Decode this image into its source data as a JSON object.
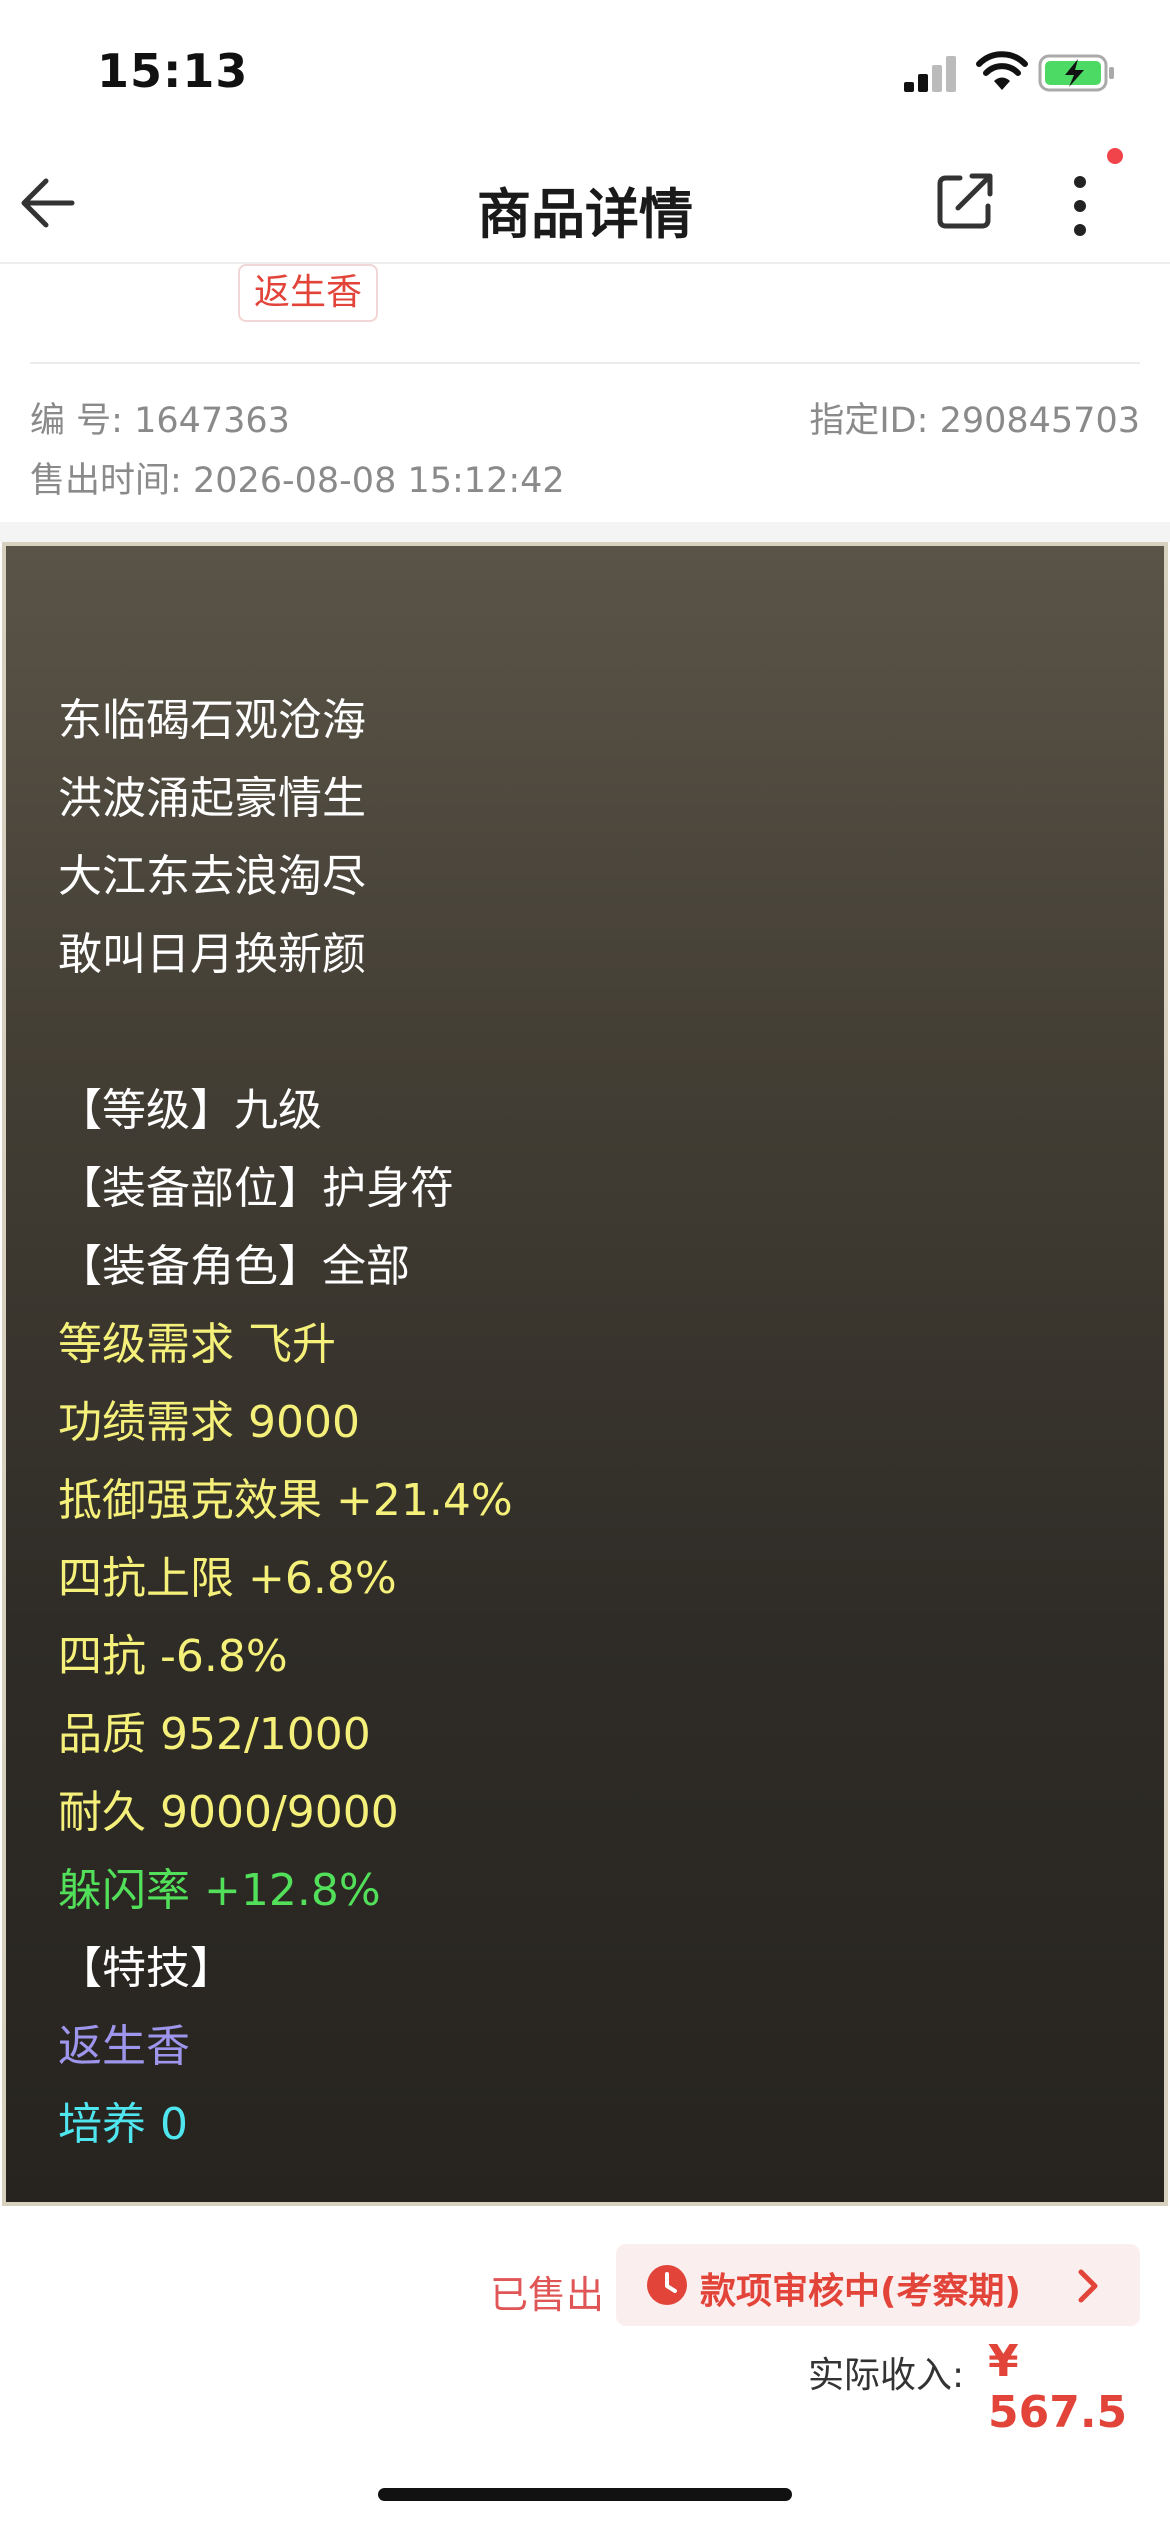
{
  "status_bar": {
    "time": "15:13"
  },
  "nav": {
    "title": "商品详情"
  },
  "tag": {
    "label": "返生香"
  },
  "meta": {
    "id_label": "编 号:",
    "id_value": "1647363",
    "assigned_id_label": "指定ID:",
    "assigned_id_value": "290845703",
    "sold_time_label": "售出时间:",
    "sold_time_value": "2026-08-08 15:12:42"
  },
  "description": {
    "lines": [
      {
        "text": "东临碣石观沧海",
        "color": "#ffffff"
      },
      {
        "text": "洪波涌起豪情生",
        "color": "#ffffff"
      },
      {
        "text": "大江东去浪淘尽",
        "color": "#ffffff"
      },
      {
        "text": "敢叫日月换新颜",
        "color": "#ffffff"
      },
      {
        "text": "【等级】九级",
        "color": "#ffffff"
      },
      {
        "text": "【装备部位】护身符",
        "color": "#ffffff"
      },
      {
        "text": "【装备角色】全部",
        "color": "#ffffff"
      },
      {
        "text": "等级需求 飞升",
        "color": "#f5f07a"
      },
      {
        "text": "功绩需求 9000",
        "color": "#f5f07a"
      },
      {
        "text": "抵御强克效果 +21.4%",
        "color": "#f5f07a"
      },
      {
        "text": "四抗上限 +6.8%",
        "color": "#f5f07a"
      },
      {
        "text": "四抗 -6.8%",
        "color": "#f5f07a"
      },
      {
        "text": "品质 952/1000",
        "color": "#f5f07a"
      },
      {
        "text": "耐久 9000/9000",
        "color": "#f5f07a"
      },
      {
        "text": "躲闪率 +12.8%",
        "color": "#52e05a"
      },
      {
        "text": "【特技】",
        "color": "#ffffff"
      },
      {
        "text": "返生香",
        "color": "#9e96ec"
      },
      {
        "text": "培养 0",
        "color": "#4fe6f0"
      }
    ]
  },
  "status": {
    "sold_label": "已售出",
    "audit_label": "款项审核中(考察期)",
    "income_label": "实际收入:",
    "income_value": "¥ 567.5"
  },
  "colors": {
    "accent": "#e2443a",
    "panel_border": "#d7d0bf"
  }
}
